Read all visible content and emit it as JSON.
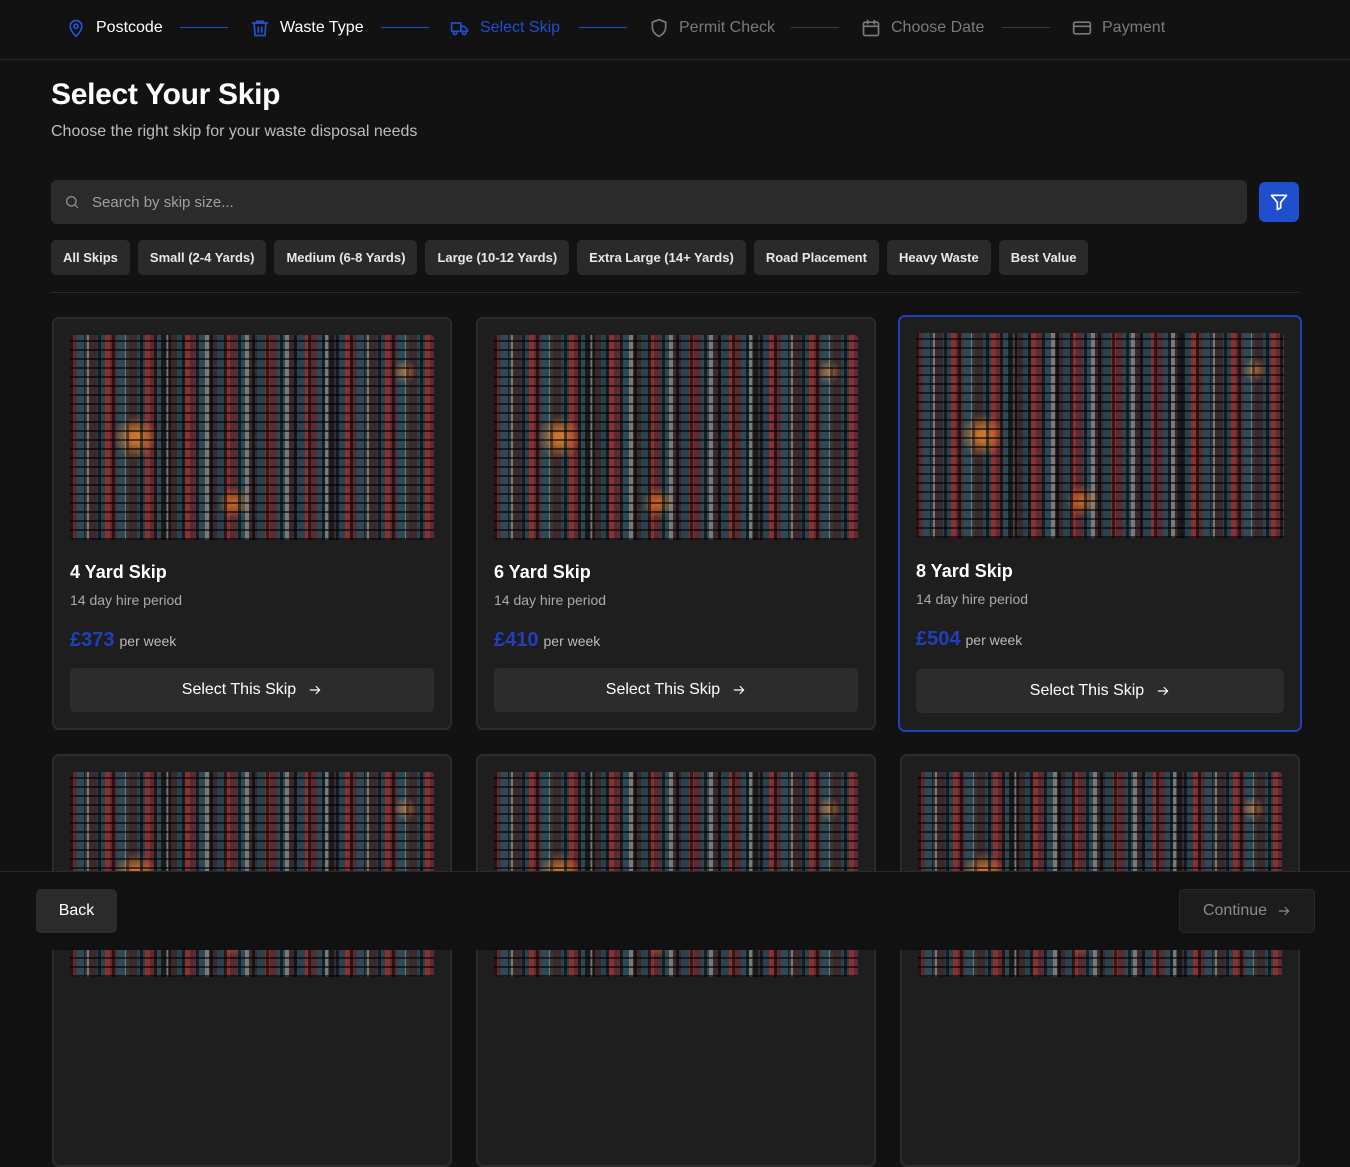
{
  "stepper": {
    "steps": [
      {
        "label": "Postcode",
        "icon": "map-pin-icon",
        "state": "done"
      },
      {
        "label": "Waste Type",
        "icon": "trash-icon",
        "state": "done"
      },
      {
        "label": "Select Skip",
        "icon": "truck-icon",
        "state": "active"
      },
      {
        "label": "Permit Check",
        "icon": "shield-icon",
        "state": "todo"
      },
      {
        "label": "Choose Date",
        "icon": "calendar-icon",
        "state": "todo"
      },
      {
        "label": "Payment",
        "icon": "credit-card-icon",
        "state": "todo"
      }
    ]
  },
  "header": {
    "title": "Select Your Skip",
    "subtitle": "Choose the right skip for your waste disposal needs"
  },
  "search": {
    "placeholder": "Search by skip size...",
    "value": ""
  },
  "filters": [
    "All Skips",
    "Small (2-4 Yards)",
    "Medium (6-8 Yards)",
    "Large (10-12 Yards)",
    "Extra Large (14+ Yards)",
    "Road Placement",
    "Heavy Waste",
    "Best Value"
  ],
  "skips": [
    {
      "name": "4 Yard Skip",
      "hire": "14 day hire period",
      "price": "£373",
      "per": "per week",
      "button": "Select This Skip",
      "selected": false
    },
    {
      "name": "6 Yard Skip",
      "hire": "14 day hire period",
      "price": "£410",
      "per": "per week",
      "button": "Select This Skip",
      "selected": false
    },
    {
      "name": "8 Yard Skip",
      "hire": "14 day hire period",
      "price": "£504",
      "per": "per week",
      "button": "Select This Skip",
      "selected": true
    }
  ],
  "footer": {
    "back_label": "Back",
    "continue_label": "Continue"
  },
  "colors": {
    "accent": "#1f4fcf",
    "background": "#121212",
    "card": "#1e1e1e"
  }
}
